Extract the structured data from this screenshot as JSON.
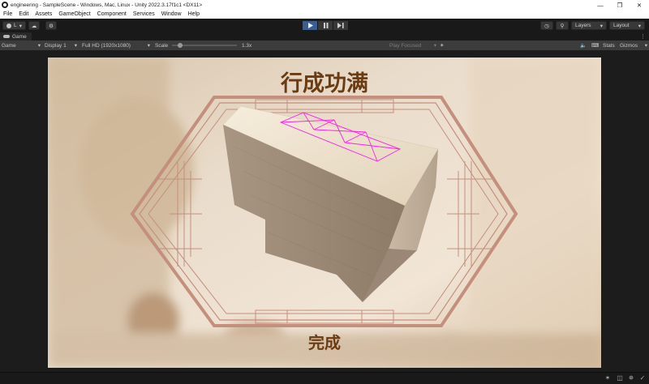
{
  "window": {
    "title": "engineering - SampleScene - Windows, Mac, Linux - Unity 2022.3.17f1c1 <DX11>"
  },
  "menu": [
    "File",
    "Edit",
    "Assets",
    "GameObject",
    "Component",
    "Services",
    "Window",
    "Help"
  ],
  "toolbar": {
    "account_label": "L",
    "layers_label": "Layers",
    "layout_label": "Layout",
    "play_state": "playing"
  },
  "tab": {
    "label": "Game"
  },
  "game_toolbar": {
    "mode": "Game",
    "display": "Display 1",
    "resolution": "Full HD (1920x1080)",
    "scale_label": "Scale",
    "scale_value": "1.3x",
    "play_focused": "Play Focused",
    "stats": "Stats",
    "gizmos": "Gizmos"
  },
  "game": {
    "title": "行成功满",
    "subtitle": "完成"
  },
  "colors": {
    "accent_play": "#3b5e8f",
    "frame": "#c48f7d",
    "title_text": "#6b3b12",
    "wireframe": "#ff1fe6"
  }
}
